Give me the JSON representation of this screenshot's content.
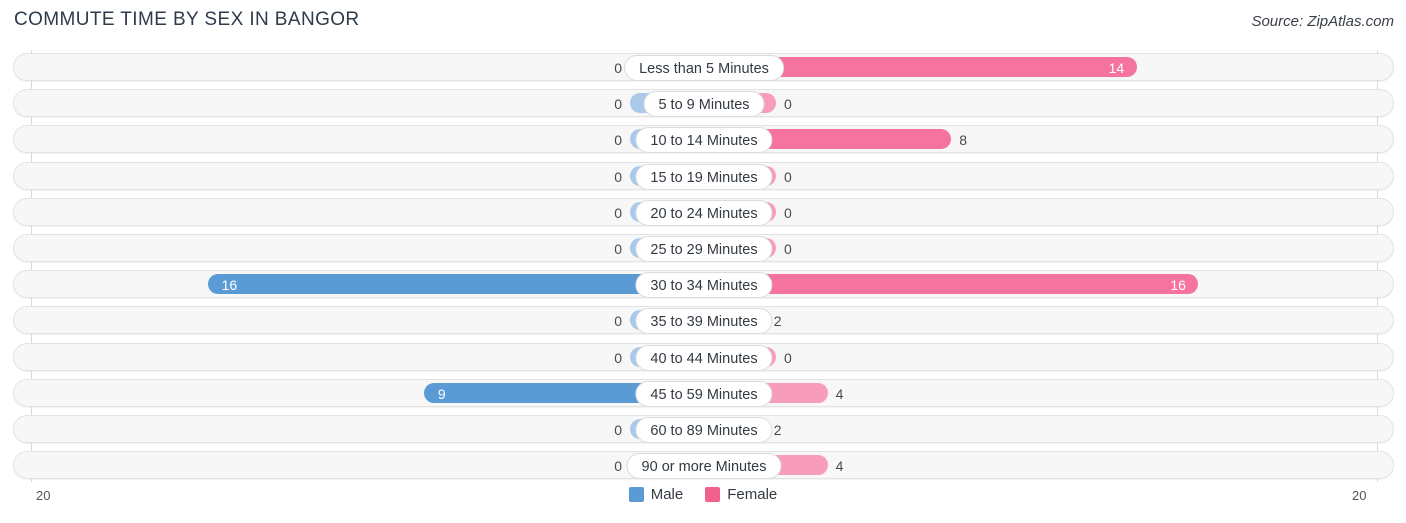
{
  "header": {
    "title": "COMMUTE TIME BY SEX IN BANGOR",
    "source": "Source: ZipAtlas.com"
  },
  "axis": {
    "left_label": "20",
    "right_label": "20",
    "max": 20
  },
  "legend": {
    "items": [
      {
        "label": "Male",
        "color": "#5b9bd5"
      },
      {
        "label": "Female",
        "color": "#f2608e"
      }
    ]
  },
  "chart_data": {
    "type": "bar",
    "orientation": "horizontal-diverging",
    "title": "COMMUTE TIME BY SEX IN BANGOR",
    "xlabel": "",
    "ylabel": "",
    "xlim": [
      20,
      20
    ],
    "grid": true,
    "legend_position": "bottom-center",
    "categories": [
      "Less than 5 Minutes",
      "5 to 9 Minutes",
      "10 to 14 Minutes",
      "15 to 19 Minutes",
      "20 to 24 Minutes",
      "25 to 29 Minutes",
      "30 to 34 Minutes",
      "35 to 39 Minutes",
      "40 to 44 Minutes",
      "45 to 59 Minutes",
      "60 to 89 Minutes",
      "90 or more Minutes"
    ],
    "series": [
      {
        "name": "Male",
        "color": "#5b9bd5",
        "values": [
          0,
          0,
          0,
          0,
          0,
          0,
          16,
          0,
          0,
          9,
          0,
          0
        ]
      },
      {
        "name": "Female",
        "color": "#f2608e",
        "values": [
          14,
          0,
          8,
          0,
          0,
          0,
          16,
          2,
          0,
          4,
          2,
          4
        ]
      }
    ]
  },
  "rows": [
    {
      "label": "Less than 5 Minutes",
      "male": "0",
      "female": "14"
    },
    {
      "label": "5 to 9 Minutes",
      "male": "0",
      "female": "0"
    },
    {
      "label": "10 to 14 Minutes",
      "male": "0",
      "female": "8"
    },
    {
      "label": "15 to 19 Minutes",
      "male": "0",
      "female": "0"
    },
    {
      "label": "20 to 24 Minutes",
      "male": "0",
      "female": "0"
    },
    {
      "label": "25 to 29 Minutes",
      "male": "0",
      "female": "0"
    },
    {
      "label": "30 to 34 Minutes",
      "male": "16",
      "female": "16"
    },
    {
      "label": "35 to 39 Minutes",
      "male": "0",
      "female": "2"
    },
    {
      "label": "40 to 44 Minutes",
      "male": "0",
      "female": "0"
    },
    {
      "label": "45 to 59 Minutes",
      "male": "9",
      "female": "4"
    },
    {
      "label": "60 to 89 Minutes",
      "male": "0",
      "female": "2"
    },
    {
      "label": "90 or more Minutes",
      "male": "0",
      "female": "4"
    }
  ]
}
